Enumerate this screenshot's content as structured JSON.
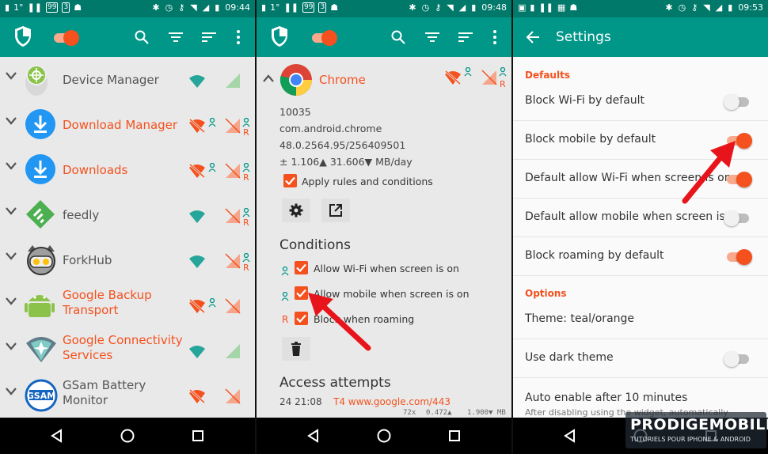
{
  "status_bars": [
    {
      "left_text": "1°",
      "box1": "99",
      "box2": "3",
      "time": "09:44"
    },
    {
      "left_text": "1°",
      "box1": "99",
      "box2": "3",
      "time": "09:48"
    },
    {
      "time": "09:53"
    }
  ],
  "panel1": {
    "apps": [
      {
        "name": "Device Manager",
        "highlight": false,
        "wifi_blocked": false,
        "mobile_blocked": false,
        "user": false,
        "mobile_user": false
      },
      {
        "name": "Download Manager",
        "highlight": true,
        "wifi_blocked": true,
        "mobile_blocked": true,
        "user": true,
        "mobile_user": true,
        "r": "R"
      },
      {
        "name": "Downloads",
        "highlight": true,
        "wifi_blocked": true,
        "mobile_blocked": true,
        "user": true,
        "mobile_user": true,
        "r": "R"
      },
      {
        "name": "feedly",
        "highlight": false,
        "wifi_blocked": false,
        "mobile_blocked": true,
        "user": false,
        "mobile_user": true,
        "r": "R"
      },
      {
        "name": "ForkHub",
        "highlight": false,
        "wifi_blocked": false,
        "mobile_blocked": true,
        "user": false,
        "mobile_user": true,
        "r": "R"
      },
      {
        "name": "Google Backup\nTransport",
        "highlight": true,
        "wifi_blocked": true,
        "mobile_blocked": true,
        "user": true,
        "mobile_user": false
      },
      {
        "name": "Google Connectivity\nServices",
        "highlight": true,
        "wifi_blocked": false,
        "mobile_blocked": false,
        "user": false,
        "mobile_user": false
      },
      {
        "name": "GSam Battery\nMonitor",
        "highlight": false,
        "wifi_blocked": true,
        "mobile_blocked": true,
        "user": false,
        "mobile_user": false
      }
    ]
  },
  "panel2": {
    "app_name": "Chrome",
    "r": "R",
    "uid": "10035",
    "package": "com.android.chrome",
    "version": "48.0.2564.95/256409501",
    "traffic": "± 1.106▲ 31.606▼ MB/day",
    "apply_label": "Apply rules and conditions",
    "conditions_title": "Conditions",
    "conditions": [
      {
        "marker": "user",
        "label": "Allow Wi-Fi when screen is on"
      },
      {
        "marker": "user",
        "label": "Allow mobile when screen is on"
      },
      {
        "marker": "R",
        "label": "Block when roaming"
      }
    ],
    "access_title": "Access attempts",
    "access": {
      "time": "24 21:08",
      "dest": "T4 www.google.com/443",
      "count": "72x",
      "up": "0.472▲",
      "down": "1.900▼ MB"
    }
  },
  "panel3": {
    "title": "Settings",
    "cat_defaults": "Defaults",
    "defaults": [
      {
        "label": "Block Wi-Fi by default",
        "on": false
      },
      {
        "label": "Block mobile by default",
        "on": true
      },
      {
        "label": "Default allow Wi-Fi when screen is on",
        "on": true
      },
      {
        "label": "Default allow mobile when screen is..",
        "on": false
      },
      {
        "label": "Block roaming by default",
        "on": true
      }
    ],
    "cat_options": "Options",
    "theme": "Theme: teal/orange",
    "dark": {
      "label": "Use dark theme",
      "on": false
    },
    "auto": {
      "label": "Auto enable after 10 minutes",
      "sub": "After disabling using the widget, automatically"
    }
  },
  "watermark": {
    "brand": "PRODIGEMOBILE",
    "tagline": "TUTORIELS POUR IPHONE & ANDROID"
  },
  "colors": {
    "teal": "#009688",
    "teal_dark": "#00796b",
    "accent": "#f4511e",
    "arrow": "#e8141b"
  }
}
